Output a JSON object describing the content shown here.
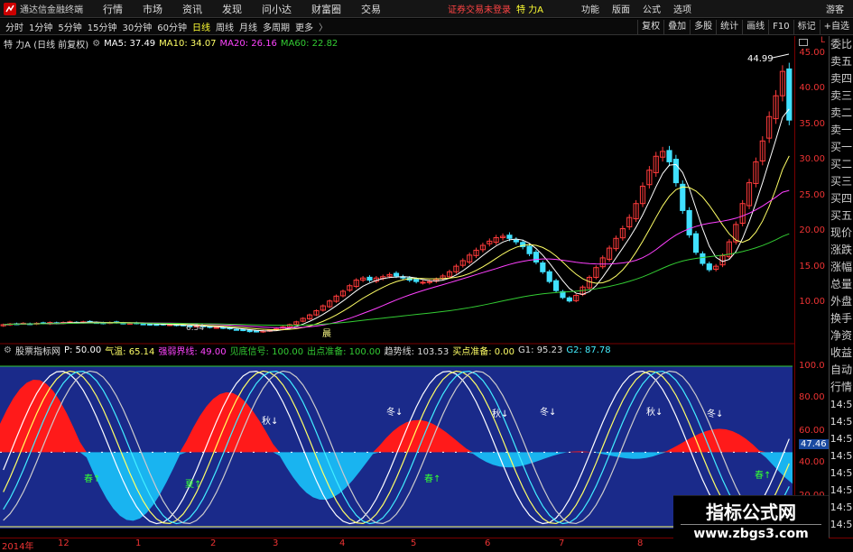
{
  "app": {
    "title": "通达信金融终端",
    "menus": [
      "行情",
      "市场",
      "资讯",
      "发现",
      "问小达",
      "财富圈",
      "交易"
    ],
    "login_msg": "证券交易未登录",
    "stock_name": "特 力A",
    "right_menus": [
      "功能",
      "版面",
      "公式",
      "选项"
    ],
    "guest": "游客"
  },
  "periods": {
    "tabs": [
      "分时",
      "1分钟",
      "5分钟",
      "15分钟",
      "30分钟",
      "60分钟",
      "日线",
      "周线",
      "月线",
      "多周期",
      "更多",
      "〉"
    ],
    "active": 6,
    "right_tools": [
      "复权",
      "叠加",
      "多股",
      "统计",
      "画线",
      "F10",
      "标记",
      "+自选"
    ]
  },
  "main_header": {
    "title": "特 力A (日线 前复权)",
    "ma5": "MA5: 37.49",
    "ma10": "MA10: 34.07",
    "ma20": "MA20: 26.16",
    "ma60": "MA60: 22.82"
  },
  "sub_header": {
    "name": "股票指标网",
    "p": "P: 50.00",
    "qiwen": "气温: 65.14",
    "qiangruo": "强弱界线: 49.00",
    "jiandi": "见底信号: 100.00",
    "chudian": "出点准备: 100.00",
    "qushi": "趋势线: 103.53",
    "maidian": "买点准备: 0.00",
    "g1": "G1: 95.23",
    "g2": "G2: 87.78"
  },
  "right_panel": [
    "委比",
    "卖五",
    "卖四",
    "卖三",
    "卖二",
    "卖一",
    "买一",
    "买二",
    "买三",
    "买四",
    "买五",
    "现价",
    "涨跌",
    "涨幅",
    "总量",
    "外盘",
    "换手",
    "净资",
    "收益",
    "自动",
    "行情",
    "14:5",
    "14:5",
    "14:5",
    "14:5",
    "14:5",
    "14:5",
    "14:5",
    "14:5",
    "14:5"
  ],
  "price_axis": [
    "45.00",
    "40.00",
    "35.00",
    "30.00",
    "25.00",
    "20.00",
    "15.00",
    "10.00"
  ],
  "sub_axis": [
    "100.0",
    "80.00",
    "60.00",
    "47.46",
    "40.00",
    "20.00"
  ],
  "annotations": {
    "high": "44.99",
    "low": "6.54",
    "season_labels": [
      "秋↓",
      "冬↓",
      "秋↓",
      "冬↓",
      "秋↓",
      "冬↓",
      "夏↑",
      "春↑",
      "春↑",
      "春↑"
    ],
    "event": "晨"
  },
  "date_axis": [
    "2014年",
    "12",
    "1",
    "2",
    "3",
    "4",
    "5",
    "6",
    "7",
    "8"
  ],
  "watermark": {
    "line1": "指标公式网",
    "line2": "www.zbgs3.com"
  },
  "colors": {
    "up": "#ff3b3b",
    "down": "#40e0ff",
    "ma5": "#ffffff",
    "ma10": "#ffff66",
    "ma20": "#ff40ff",
    "ma60": "#33cc33",
    "sub_bg": "#1a2a8a",
    "red_area": "#ff1a1a",
    "cyan_area": "#19b4f0"
  },
  "chart_data": {
    "type": "candlestick",
    "ylim": [
      5,
      47
    ],
    "closes": [
      7.6,
      7.7,
      7.7,
      7.8,
      7.7,
      7.8,
      7.8,
      7.9,
      7.8,
      7.9,
      8.0,
      7.9,
      8.0,
      8.0,
      7.9,
      7.8,
      7.9,
      7.9,
      7.8,
      7.8,
      7.8,
      7.7,
      7.6,
      7.6,
      7.6,
      7.6,
      7.5,
      7.5,
      7.4,
      7.4,
      7.3,
      7.2,
      7.2,
      7.1,
      7.0,
      6.9,
      6.8,
      6.6,
      6.6,
      6.7,
      6.8,
      7.0,
      7.3,
      7.6,
      8.0,
      8.5,
      9.0,
      9.6,
      10.3,
      11.0,
      11.7,
      12.4,
      13.2,
      14.0,
      14.3,
      14.0,
      14.3,
      14.5,
      14.8,
      14.6,
      14.3,
      14.0,
      13.8,
      13.7,
      13.8,
      14.1,
      14.6,
      15.2,
      16.0,
      16.8,
      17.6,
      18.3,
      19.0,
      19.6,
      20.1,
      20.3,
      20.0,
      19.5,
      18.8,
      17.8,
      16.6,
      15.2,
      13.8,
      12.5,
      11.5,
      11.0,
      11.8,
      13.0,
      14.4,
      15.8,
      17.2,
      18.6,
      20.0,
      21.4,
      23.0,
      25.0,
      27.5,
      29.8,
      31.8,
      32.5,
      31.0,
      28.0,
      24.0,
      20.5,
      18.0,
      16.4,
      15.5,
      16.0,
      17.5,
      19.5,
      22.0,
      25.0,
      28.0,
      31.0,
      34.0,
      37.5,
      40.5,
      44.0,
      37.0
    ]
  }
}
